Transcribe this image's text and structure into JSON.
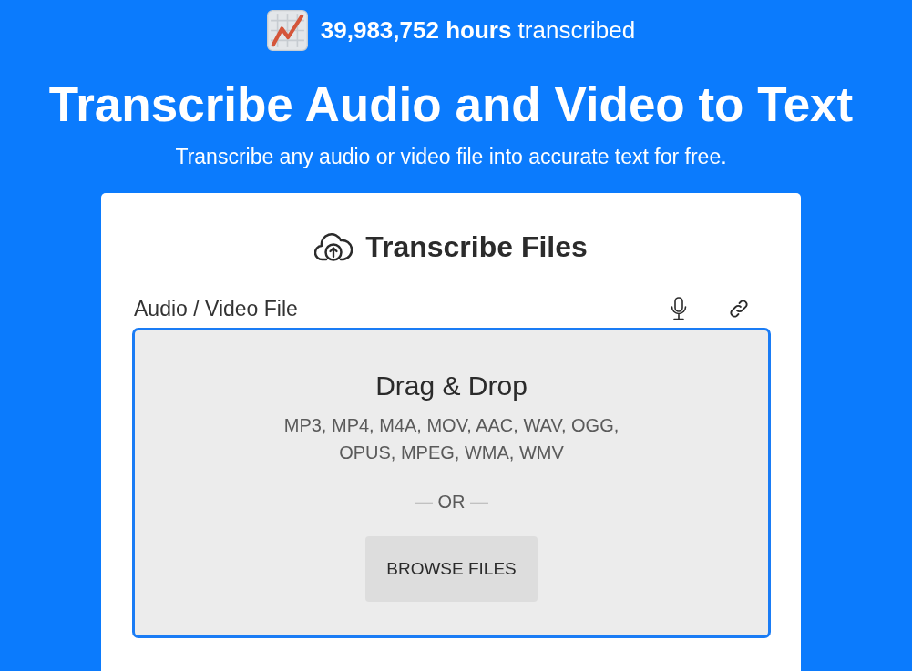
{
  "stats": {
    "text": "**39,983,752 hours** transcribed"
  },
  "hero": {
    "title": "Transcribe Audio and Video to Text",
    "subtitle": "Transcribe any audio or video file into accurate text for free."
  },
  "card": {
    "title": "Transcribe Files",
    "field_label": "Audio / Video File",
    "dropzone": {
      "heading": "Drag & Drop",
      "formats": "MP3, MP4, M4A, MOV, AAC, WAV, OGG, OPUS, MPEG, WMA, WMV",
      "separator": "— OR —",
      "button": "BROWSE FILES"
    }
  }
}
